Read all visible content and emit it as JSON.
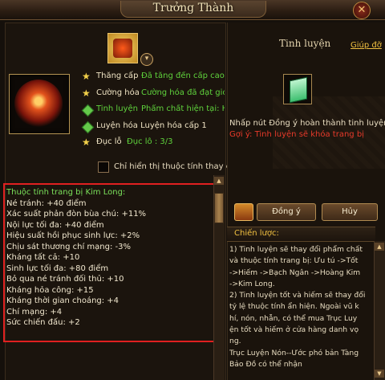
{
  "window": {
    "title": "Trưởng Thành",
    "close_label": "✕"
  },
  "left": {
    "dropdown_label": "▾",
    "rows": [
      {
        "label": "Thăng cấp",
        "value": "Đã tăng đến cấp cao nl",
        "icon": "star-icon"
      },
      {
        "label": "Cường hóa",
        "value": "Cường hóa đã đạt giớ",
        "icon": "star-icon"
      },
      {
        "label": "Tinh luyện",
        "value": "Phẩm chất hiện tại: Ho.",
        "icon": "diamond-icon",
        "label_color": "#5fd23c"
      },
      {
        "label": "Luyện hóa Luyện hóa cấp 1",
        "value": "",
        "icon": "diamond-icon"
      },
      {
        "label": "Đục lỗ",
        "value": "Đục lỗ : 3/3",
        "icon": "star-icon"
      }
    ],
    "checkbox_label": "Chỉ hiển thị thuộc tính thay ć",
    "attributes": {
      "title": "Thuộc tính trang bị Kim Long:",
      "lines": [
        "Né tránh: +40 điểm",
        "Xác suất phản đòn bùa chú: +11%",
        "Nội lực tối đa: +40 điểm",
        "Hiệu suất hồi phục sinh lực: +2%",
        "Chịu sát thương chí mạng: -3%",
        "Kháng tất cả: +10",
        "Sinh lực tối đa: +80 điểm",
        "Bỏ qua né tránh đối thủ: +10",
        "Kháng hỏa công: +15",
        "Kháng thời gian choáng: +4",
        "Chí mạng: +4",
        "Sức chiến đấu: +2"
      ]
    }
  },
  "right": {
    "title": "Tinh luyện",
    "help_link": "Giúp đỡ",
    "info_line1": "Nhấp nút Đồng ý hoàn thành tinh luyện",
    "info_line2": "Gợi ý: Tinh luyện sẽ khóa trang bị",
    "ok_button": "Đồng ý",
    "cancel_button": "Hủy",
    "strategy_title": "Chiến lược:",
    "strategy_lines": [
      "1) Tinh luyện sẽ thay đổi phẩm chất",
      "và thuộc tính trang bị: Ưu tú ->Tốt",
      "->Hiếm ->Bạch Ngân ->Hoàng Kim",
      "->Kim Long.",
      "2) Tinh luyện tốt và hiếm sẽ thay đổi",
      "tỷ lệ thuộc tính ẩn hiện. Ngoài vũ k",
      "hí, nón, nhẫn, có thể mua Trục Luy",
      "ện tốt và hiếm ở cửa hàng danh vọ",
      "ng.",
      "Trục Luyện Nón--Ước phó bản Tàng",
      "Bảo Đồ có thể nhận"
    ]
  },
  "colors": {
    "highlight_green": "#5fd23c",
    "warning_red": "#e83a2a",
    "gold": "#f0c040",
    "attr_box_border": "#e02020"
  }
}
